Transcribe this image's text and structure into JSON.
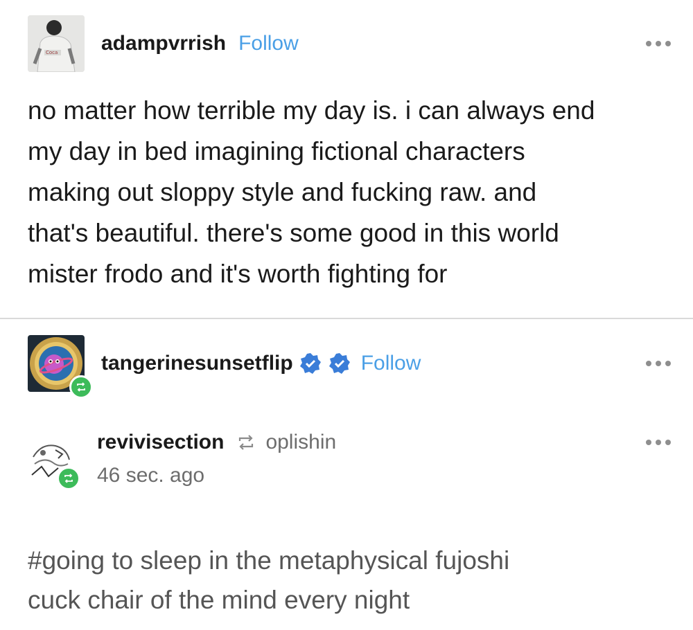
{
  "post": {
    "author": "adampvrrish",
    "follow_label": "Follow",
    "body_lines": [
      "no matter how terrible my day is. i can always end",
      "my day in bed imagining fictional characters",
      "making out sloppy style and fucking raw. and",
      "that's beautiful. there's some good in this world",
      "mister frodo and it's worth fighting for"
    ]
  },
  "reblog1": {
    "author": "tangerinesunsetflip",
    "follow_label": "Follow"
  },
  "reblog2": {
    "author": "revivisection",
    "source": "oplishin",
    "time": "46 sec. ago",
    "tag_lines": [
      "#going to sleep in the metaphysical fujoshi",
      "cuck chair of the mind every night"
    ]
  },
  "icons": {
    "more": "more-options-icon",
    "reblog": "reblog-icon",
    "verified": "verified-badge-icon"
  },
  "colors": {
    "follow": "#4a9fe6",
    "reblog_badge": "#3dbb5a",
    "verified": "#3a7dd8",
    "tags": "#555555"
  }
}
